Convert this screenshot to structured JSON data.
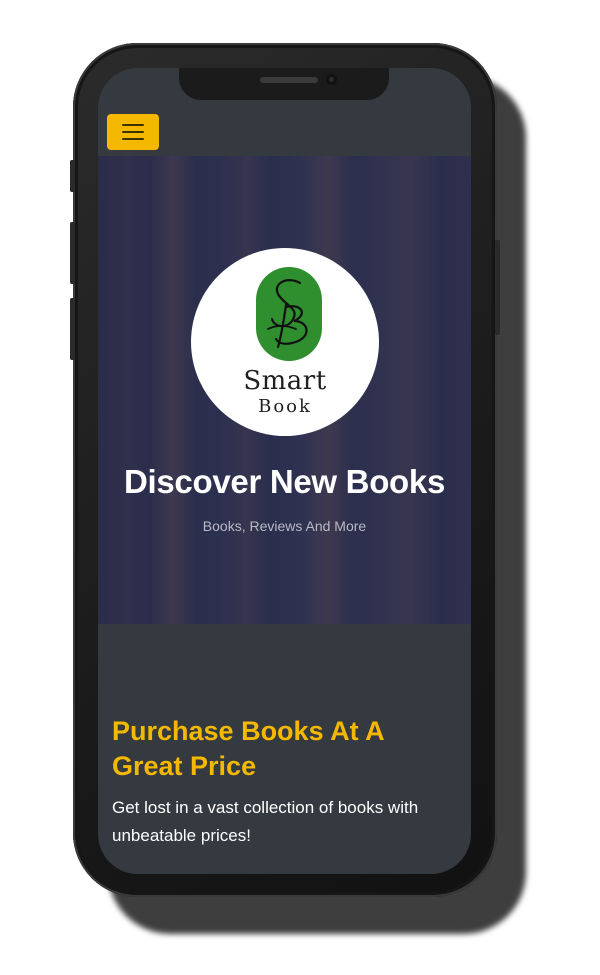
{
  "nav": {
    "menu_icon": "hamburger-menu-icon",
    "menu_color": "#f5b800"
  },
  "logo": {
    "monogram": "SB",
    "word1": "Smart",
    "word2": "Book",
    "color": "#2f8f2f"
  },
  "hero": {
    "title": "Discover New Books",
    "subtitle": "Books, Reviews And More"
  },
  "feature": {
    "title": "Purchase Books At A Great Price",
    "text": "Get lost in a vast collection of books with unbeatable prices!"
  },
  "colors": {
    "accent": "#f5b800",
    "background": "#343a40",
    "logo_green": "#2f8f2f"
  }
}
